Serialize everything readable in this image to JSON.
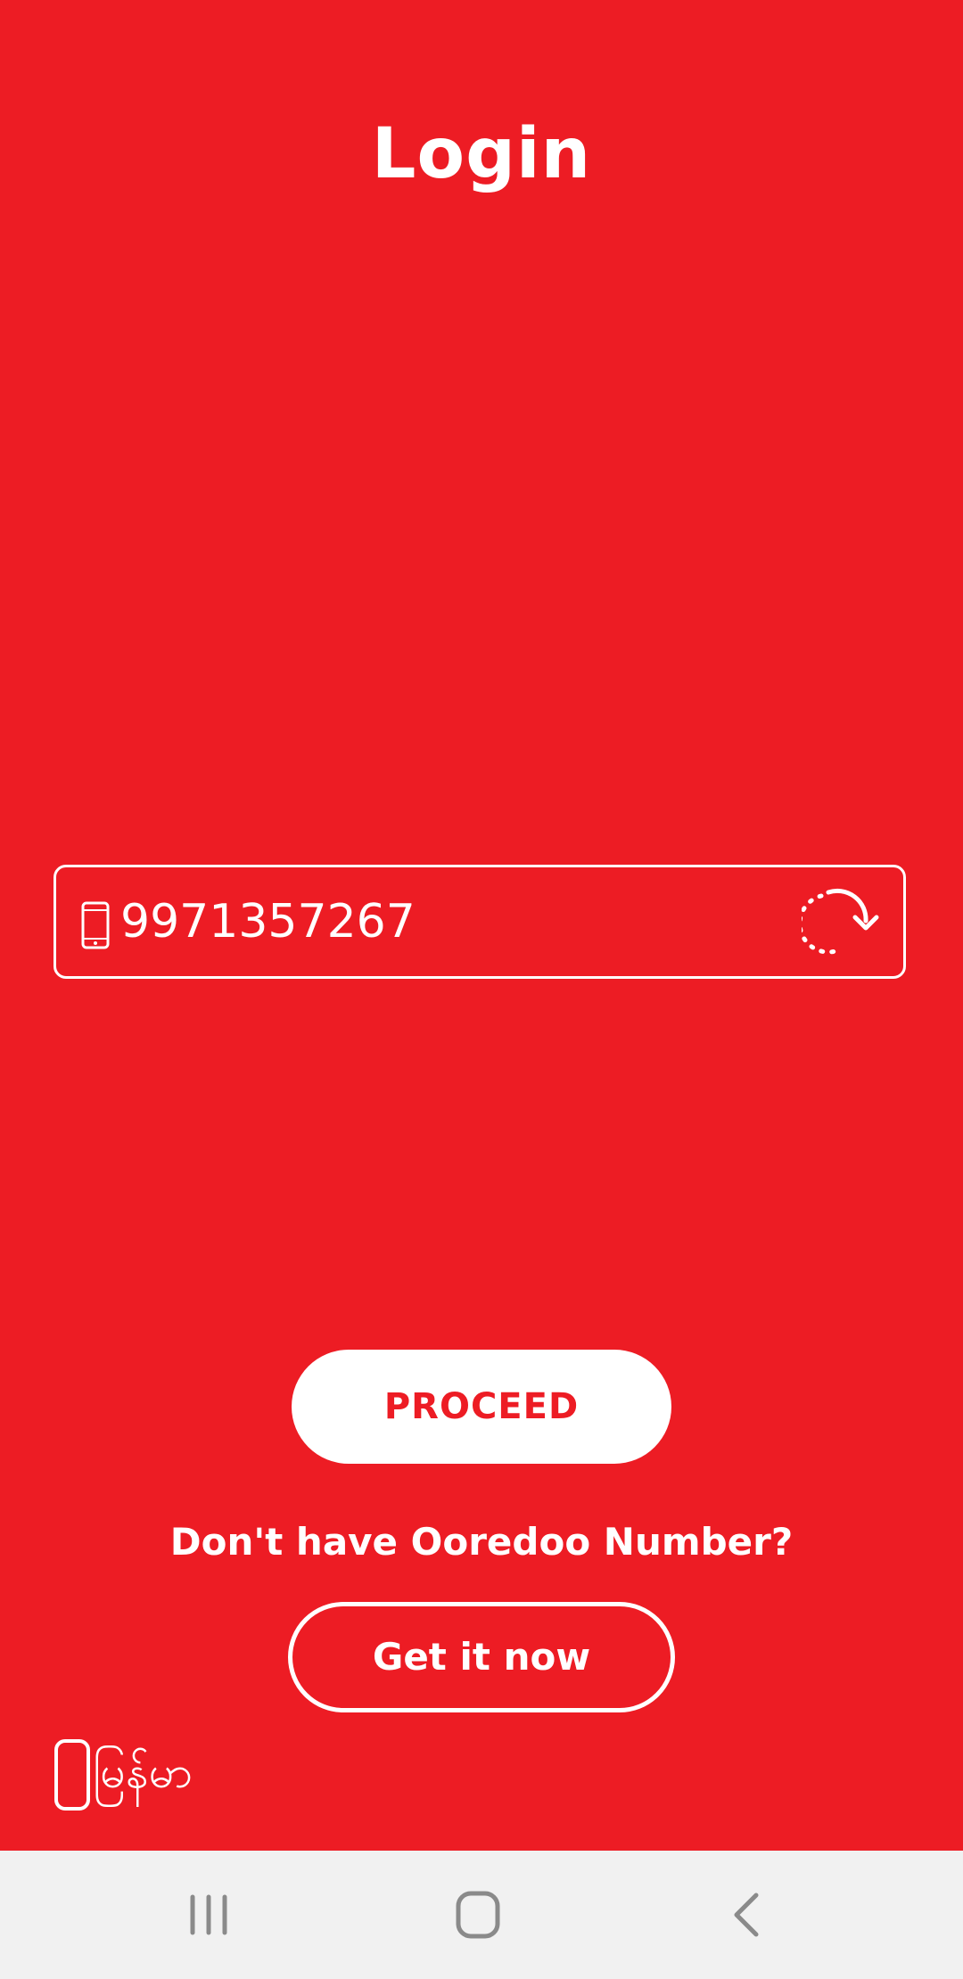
{
  "screen": {
    "title": "Login"
  },
  "login_form": {
    "phone_icon": "smartphone-icon",
    "phone_number": "9971357267",
    "refresh_icon": "refresh-icon"
  },
  "actions": {
    "proceed_label": "PROCEED",
    "question": "Don't have Ooredoo Number?",
    "get_it_now_label": "Get it now"
  },
  "language": {
    "icon": "phone-outline-icon",
    "label": "မြန်မာ"
  },
  "system_nav": {
    "recents_icon": "recents-icon",
    "home_icon": "home-icon",
    "back_icon": "back-icon"
  },
  "colors": {
    "brand_red": "#ed1c24",
    "white": "#ffffff",
    "nav_bg": "#f1f1f1",
    "nav_icon": "#8a8a8a"
  }
}
